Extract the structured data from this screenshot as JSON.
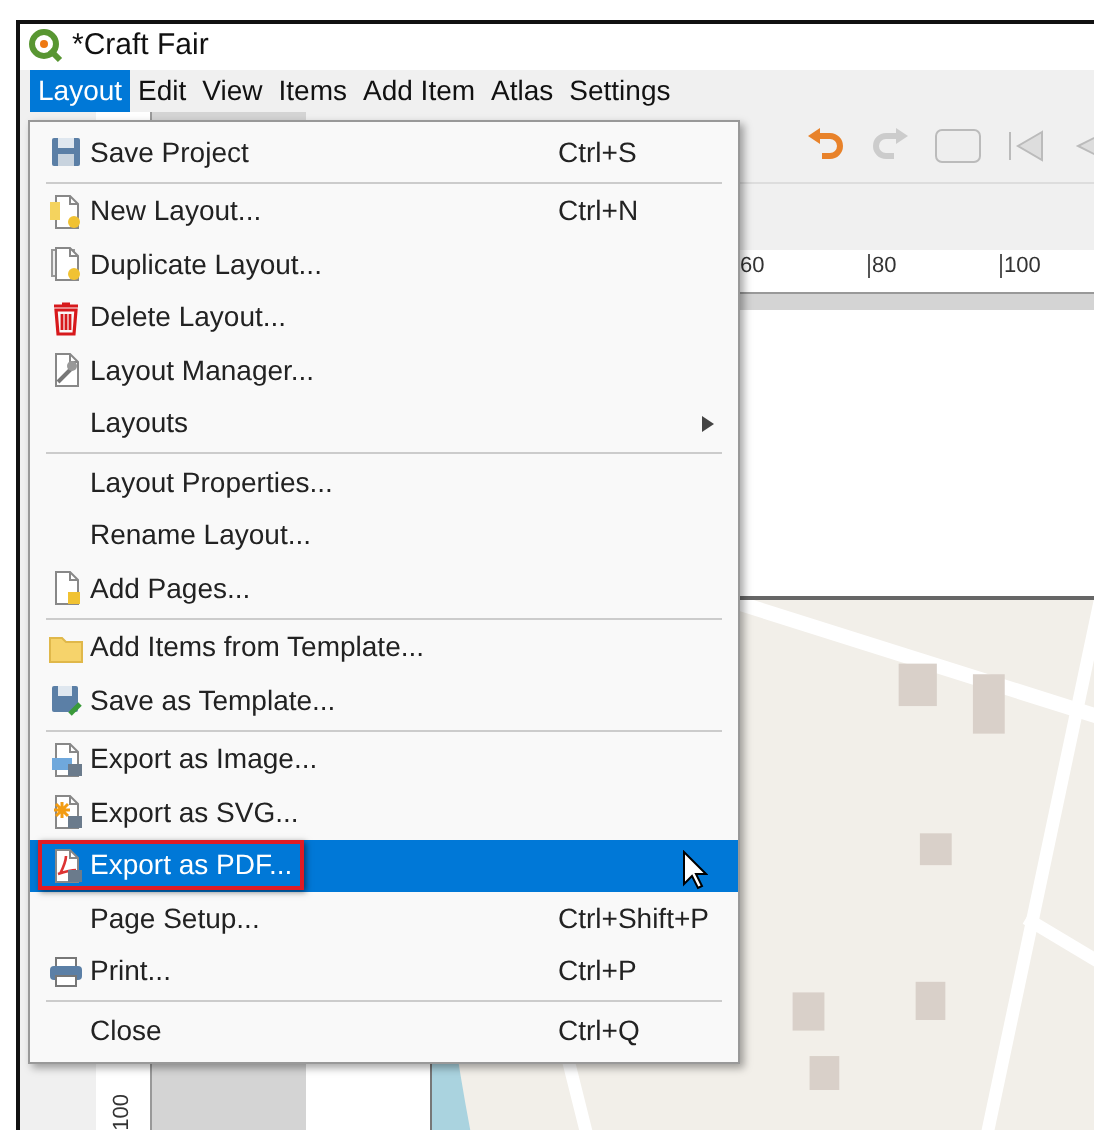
{
  "window": {
    "title": "*Craft Fair"
  },
  "menubar": [
    {
      "label": "Layout",
      "selected": true
    },
    {
      "label": "Edit",
      "selected": false
    },
    {
      "label": "View",
      "selected": false
    },
    {
      "label": "Items",
      "selected": false
    },
    {
      "label": "Add Item",
      "selected": false
    },
    {
      "label": "Atlas",
      "selected": false
    },
    {
      "label": "Settings",
      "selected": false
    }
  ],
  "menu": [
    {
      "kind": "item",
      "label": "Save Project",
      "shortcut": "Ctrl+S",
      "selected": false,
      "annotated": false
    },
    {
      "kind": "separator"
    },
    {
      "kind": "item",
      "label": "New Layout...",
      "shortcut": "Ctrl+N",
      "selected": false,
      "annotated": false
    },
    {
      "kind": "item",
      "label": "Duplicate Layout...",
      "selected": false,
      "annotated": false
    },
    {
      "kind": "item",
      "label": "Delete Layout...",
      "selected": false,
      "annotated": false
    },
    {
      "kind": "item",
      "label": "Layout Manager...",
      "selected": false,
      "annotated": false
    },
    {
      "kind": "submenu",
      "label": "Layouts",
      "selected": false
    },
    {
      "kind": "separator"
    },
    {
      "kind": "item",
      "label": "Layout Properties...",
      "selected": false,
      "annotated": false
    },
    {
      "kind": "item",
      "label": "Rename Layout...",
      "selected": false,
      "annotated": false
    },
    {
      "kind": "item",
      "label": "Add Pages...",
      "selected": false,
      "annotated": false
    },
    {
      "kind": "separator"
    },
    {
      "kind": "item",
      "label": "Add Items from Template...",
      "selected": false,
      "annotated": false
    },
    {
      "kind": "item",
      "label": "Save as Template...",
      "selected": false,
      "annotated": false
    },
    {
      "kind": "separator"
    },
    {
      "kind": "item",
      "label": "Export as Image...",
      "selected": false,
      "annotated": false
    },
    {
      "kind": "item",
      "label": "Export as SVG...",
      "selected": false,
      "annotated": false
    },
    {
      "kind": "item",
      "label": "Export as PDF...",
      "selected": true,
      "annotated": true
    },
    {
      "kind": "item",
      "label": "Page Setup...",
      "shortcut": "Ctrl+Shift+P",
      "selected": false,
      "annotated": false
    },
    {
      "kind": "item",
      "label": "Print...",
      "shortcut": "Ctrl+P",
      "selected": false,
      "annotated": false
    },
    {
      "kind": "separator"
    },
    {
      "kind": "item",
      "label": "Close",
      "shortcut": "Ctrl+Q",
      "selected": false,
      "annotated": false
    }
  ],
  "ruler": {
    "top_labels": [
      "60",
      "80",
      "100"
    ],
    "side_label": "100"
  }
}
